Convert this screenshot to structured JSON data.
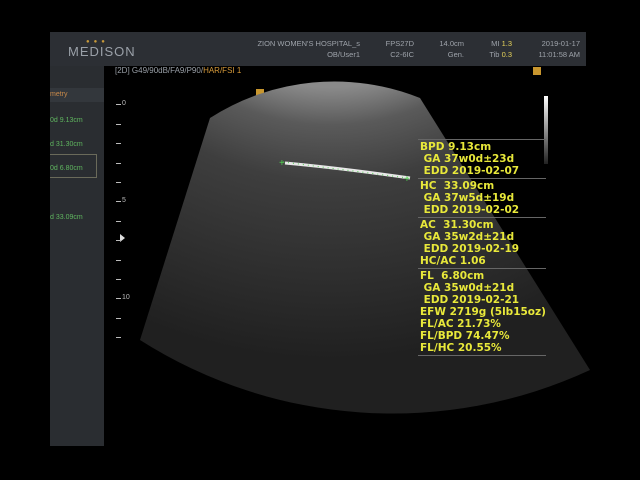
{
  "header": {
    "brand": "MEDISON",
    "hospital": "ZION WOMEN'S HOSPITAL_s",
    "user": "OB/User1",
    "frame_rate": "FPS27D",
    "probe": "C2-6IC",
    "depth": "14.0cm",
    "mode": "Gen.",
    "mi_label": "MI",
    "mi_value": "1.3",
    "tib_label": "Tib",
    "tib_value": "0.3",
    "date": "2019-01-17",
    "time": "11:01:58 AM"
  },
  "params": {
    "main": "[2D] G49/90dB/FA9/P90/",
    "har": "HAR/FSI 1"
  },
  "sidebar": {
    "header": "metry",
    "items": [
      "0d  9.13cm",
      "d  31.30cm",
      "0d  6.80cm",
      "d  33.09cm"
    ]
  },
  "scale": {
    "labels": [
      "0",
      "5",
      "10"
    ]
  },
  "measurements": [
    [
      "BPD 9.13cm",
      " GA 37w0d±23d",
      " EDD 2019-02-07"
    ],
    [
      "HC  33.09cm",
      " GA 37w5d±19d",
      " EDD 2019-02-02"
    ],
    [
      "AC  31.30cm",
      " GA 35w2d±21d",
      " EDD 2019-02-19",
      "HC/AC 1.06"
    ],
    [
      "FL  6.80cm",
      " GA 35w0d±21d",
      " EDD 2019-02-21",
      "EFW 2719g (5lb15oz)",
      "FL/AC 21.73%",
      "FL/BPD 74.47%",
      "FL/HC 20.55%"
    ]
  ],
  "colors": {
    "measure_text": "#e8e83a",
    "caliper": "#4fd04f",
    "marker": "#c8962e"
  }
}
